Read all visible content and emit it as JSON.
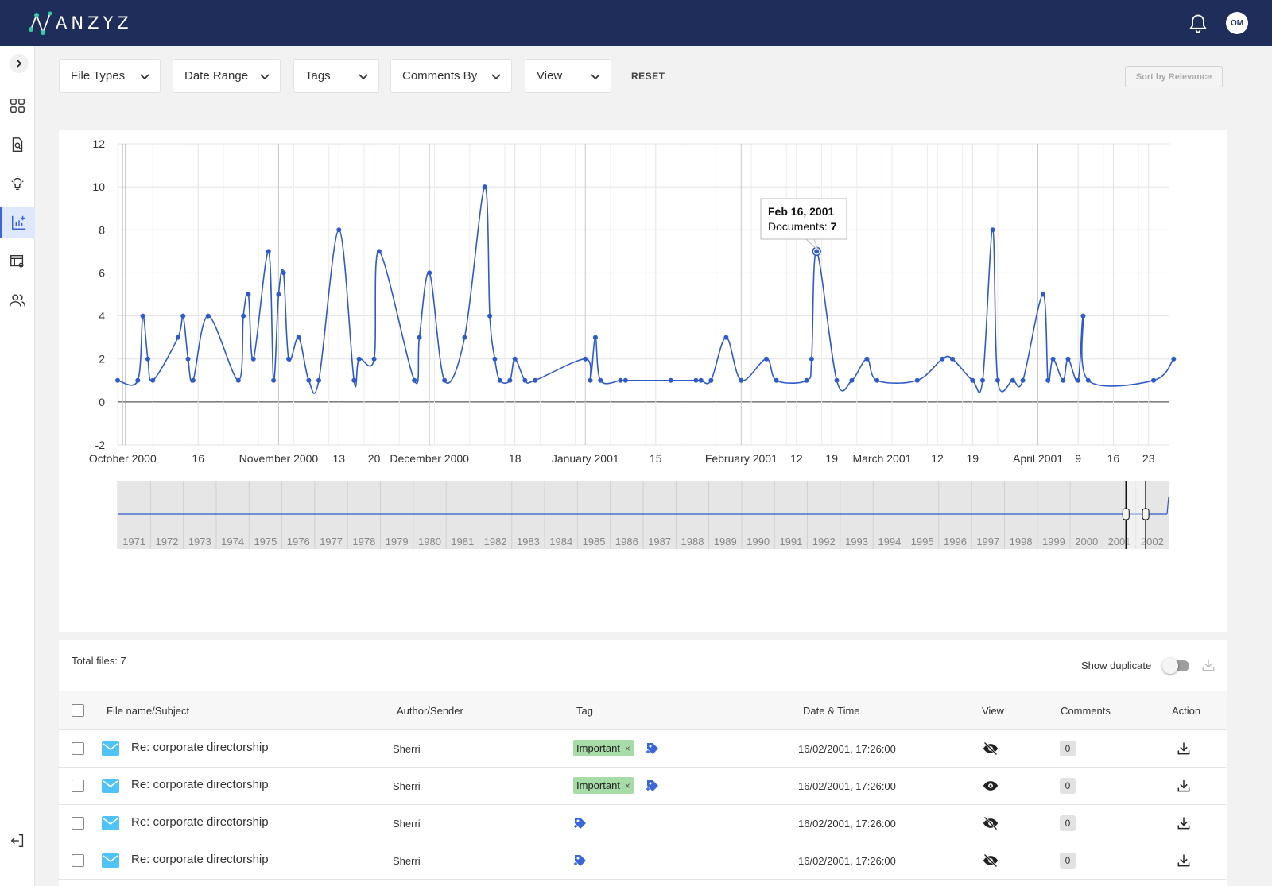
{
  "app": {
    "logo_text": "ANZYZ",
    "user_initials": "OM"
  },
  "filters": {
    "file_types": "File Types",
    "date_range": "Date Range",
    "tags": "Tags",
    "comments_by": "Comments By",
    "view": "View",
    "reset": "RESET",
    "sort": "Sort by Relevance"
  },
  "tooltip": {
    "date": "Feb 16, 2001",
    "label": "Documents: ",
    "value": "7"
  },
  "chart_data": {
    "type": "line",
    "ylim": [
      -2,
      12
    ],
    "yticks": [
      -2,
      0,
      2,
      4,
      6,
      8,
      10,
      12
    ],
    "xlim": [
      "2000-09-30",
      "2001-04-27"
    ],
    "x_tick_labels": [
      {
        "date": "2000-10-01",
        "label": "October 2000"
      },
      {
        "date": "2000-10-16",
        "label": "16"
      },
      {
        "date": "2000-11-01",
        "label": "November 2000"
      },
      {
        "date": "2000-11-13",
        "label": "13"
      },
      {
        "date": "2000-11-20",
        "label": "20"
      },
      {
        "date": "2000-12-01",
        "label": "December 2000"
      },
      {
        "date": "2000-12-18",
        "label": "18"
      },
      {
        "date": "2001-01-01",
        "label": "January 2001"
      },
      {
        "date": "2001-01-15",
        "label": "15"
      },
      {
        "date": "2001-02-01",
        "label": "February 2001"
      },
      {
        "date": "2001-02-12",
        "label": "12"
      },
      {
        "date": "2001-02-19",
        "label": "19"
      },
      {
        "date": "2001-03-01",
        "label": "March 2001"
      },
      {
        "date": "2001-03-12",
        "label": "12"
      },
      {
        "date": "2001-03-19",
        "label": "19"
      },
      {
        "date": "2001-04-01",
        "label": "April 2001"
      },
      {
        "date": "2001-04-09",
        "label": "9"
      },
      {
        "date": "2001-04-16",
        "label": "16"
      },
      {
        "date": "2001-04-23",
        "label": "23"
      }
    ],
    "series": [
      {
        "x": [
          "2000-09-30",
          "2000-10-04",
          "2000-10-05",
          "2000-10-06",
          "2000-10-07",
          "2000-10-12",
          "2000-10-13",
          "2000-10-14",
          "2000-10-15",
          "2000-10-18",
          "2000-10-24",
          "2000-10-25",
          "2000-10-26",
          "2000-10-27",
          "2000-10-30",
          "2000-10-31",
          "2000-11-01",
          "2000-11-02",
          "2000-11-03",
          "2000-11-05",
          "2000-11-07",
          "2000-11-09",
          "2000-11-13",
          "2000-11-16",
          "2000-11-17",
          "2000-11-20",
          "2000-11-21",
          "2000-11-28",
          "2000-11-29",
          "2000-12-01",
          "2000-12-04",
          "2000-12-08",
          "2000-12-12",
          "2000-12-13",
          "2000-12-14",
          "2000-12-15",
          "2000-12-17",
          "2000-12-18",
          "2000-12-20",
          "2000-12-22",
          "2001-01-01",
          "2001-01-02",
          "2001-01-03",
          "2001-01-04",
          "2001-01-08",
          "2001-01-09",
          "2001-01-18",
          "2001-01-23",
          "2001-01-24",
          "2001-01-26",
          "2001-01-29",
          "2001-02-01",
          "2001-02-06",
          "2001-02-08",
          "2001-02-14",
          "2001-02-15",
          "2001-02-16",
          "2001-02-20",
          "2001-02-23",
          "2001-02-26",
          "2001-02-28",
          "2001-03-08",
          "2001-03-13",
          "2001-03-15",
          "2001-03-19",
          "2001-03-21",
          "2001-03-23",
          "2001-03-24",
          "2001-03-27",
          "2001-03-29",
          "2001-04-02",
          "2001-04-03",
          "2001-04-04",
          "2001-04-06",
          "2001-04-07",
          "2001-04-09",
          "2001-04-10",
          "2001-04-11",
          "2001-04-24",
          "2001-04-28"
        ],
        "y": [
          1,
          1,
          4,
          2,
          1,
          3,
          4,
          2,
          1,
          4,
          1,
          4,
          5,
          2,
          7,
          1,
          5,
          6,
          2,
          3,
          1,
          1,
          8,
          1,
          2,
          2,
          7,
          1,
          3,
          6,
          1,
          3,
          10,
          4,
          2,
          1,
          1,
          2,
          1,
          1,
          2,
          1,
          3,
          1,
          1,
          1,
          1,
          1,
          1,
          1,
          3,
          1,
          2,
          1,
          1,
          2,
          7,
          1,
          1,
          2,
          1,
          1,
          2,
          2,
          1,
          1,
          8,
          1,
          1,
          1,
          5,
          1,
          2,
          1,
          2,
          1,
          4,
          1,
          1,
          2
        ]
      }
    ],
    "navigator_years": [
      "1971",
      "1972",
      "1973",
      "1974",
      "1975",
      "1976",
      "1977",
      "1978",
      "1979",
      "1980",
      "1981",
      "1982",
      "1983",
      "1984",
      "1985",
      "1986",
      "1987",
      "1988",
      "1989",
      "1990",
      "1991",
      "1992",
      "1993",
      "1994",
      "1995",
      "1996",
      "1997",
      "1998",
      "1999",
      "2000",
      "2001",
      "2002"
    ]
  },
  "table": {
    "total_files": "Total files: 7",
    "show_duplicate": "Show duplicate",
    "headers": {
      "subject": "File name/Subject",
      "author": "Author/Sender",
      "tag": "Tag",
      "datetime": "Date & Time",
      "view": "View",
      "comments": "Comments",
      "action": "Action"
    },
    "rows": [
      {
        "subject": "Re: corporate directorship",
        "author": "Sherri",
        "tag": "Important",
        "datetime": "16/02/2001, 17:26:00",
        "comments": "0",
        "viewed": "hidden"
      },
      {
        "subject": "Re: corporate directorship",
        "author": "Sherri",
        "tag": "Important",
        "datetime": "16/02/2001, 17:26:00",
        "comments": "0",
        "viewed": "visible"
      },
      {
        "subject": "Re: corporate directorship",
        "author": "Sherri",
        "tag": "",
        "datetime": "16/02/2001, 17:26:00",
        "comments": "0",
        "viewed": "hidden"
      },
      {
        "subject": "Re: corporate directorship",
        "author": "Sherri",
        "tag": "",
        "datetime": "16/02/2001, 17:26:00",
        "comments": "0",
        "viewed": "hidden"
      }
    ]
  },
  "colors": {
    "header_bg": "#1f2d5a",
    "line": "#2f5ac9",
    "accent": "#3a66d8",
    "tag_green": "#a7dca8",
    "mail_icon": "#4fc3f7"
  }
}
